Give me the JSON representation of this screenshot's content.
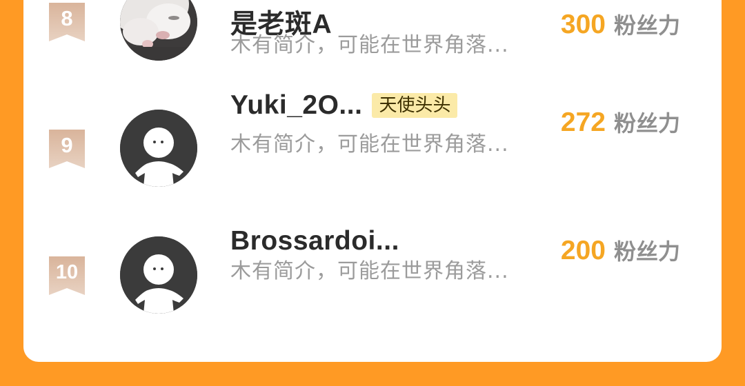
{
  "colors": {
    "page_background": "#ff9a24",
    "card_background": "#ffffff",
    "score_accent": "#f5a623",
    "rank_badge": "#cfa98f",
    "tag_background": "#fbeaa8"
  },
  "ranking": [
    {
      "rank": "8",
      "name": "是老斑A",
      "tag": "",
      "avatar": "cat-photo",
      "bio": "木有简介，可能在世界角落...",
      "score": "300",
      "score_unit": "粉丝力"
    },
    {
      "rank": "9",
      "name": "Yuki_2O...",
      "tag": "天使头头",
      "avatar": "default-user-icon",
      "bio": "木有简介，可能在世界角落...",
      "score": "272",
      "score_unit": "粉丝力"
    },
    {
      "rank": "10",
      "name": "Brossardoi...",
      "tag": "",
      "avatar": "default-user-icon",
      "bio": "木有简介，可能在世界角落...",
      "score": "200",
      "score_unit": "粉丝力"
    }
  ]
}
